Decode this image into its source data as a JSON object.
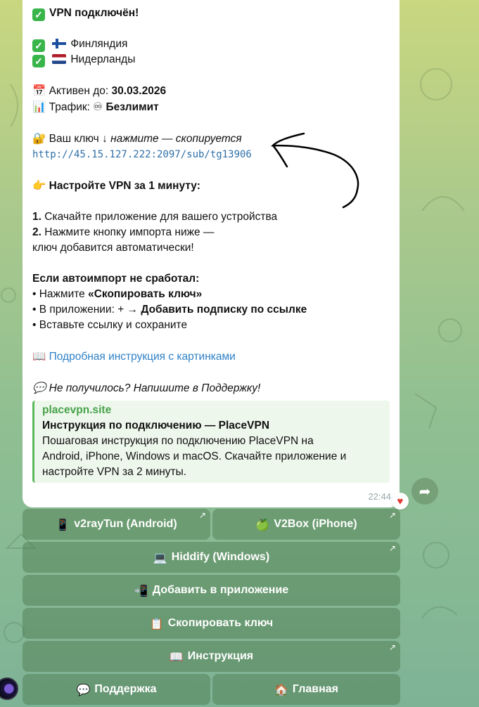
{
  "message": {
    "title": "VPN подключён!",
    "servers": [
      {
        "flag": "finland",
        "name": "Финляндия"
      },
      {
        "flag": "netherlands",
        "name": "Нидерланды"
      }
    ],
    "active_label": "Активен до:",
    "active_value": "30.03.2026",
    "traffic_label": "Трафик:",
    "traffic_value": "Безлимит",
    "key_label": "Ваш ключ ↓",
    "key_hint": "нажмите — скопируется",
    "key_url": "http://45.15.127.222:2097/sub/tg13906",
    "setup_title": "Настройте VPN за 1 минуту:",
    "step1_num": "1.",
    "step1_text": "Скачайте приложение для вашего устройства",
    "step2_num": "2.",
    "step2_text": "Нажмите кнопку импорта ниже —",
    "step2_cont": "ключ добавится автоматически!",
    "fallback_title": "Если автоимпорт не сработал:",
    "fb1_pre": "• Нажмите ",
    "fb1_bold": "«Скопировать ключ»",
    "fb2_pre": "• В приложении: + → ",
    "fb2_bold": "Добавить подписку по ссылке",
    "fb3": "• Вставьте ссылку и сохраните",
    "guide_link": "Подробная инструкция с картинками",
    "support_text": "Не получилось? Напишите в Поддержку!",
    "preview": {
      "site": "placevpn.site",
      "title": "Инструкция по подключению — PlaceVPN",
      "desc1": "Пошаговая инструкция по подключению PlaceVPN на",
      "desc2": "Android, iPhone, Windows и macOS. Скачайте приложение и",
      "desc3": "настройте VPN за 2 минуты."
    },
    "time": "22:44"
  },
  "buttons": {
    "v2raytun": "v2rayTun (Android)",
    "v2box": "V2Box (iPhone)",
    "hiddify": "Hiddify (Windows)",
    "add_app": "Добавить в приложение",
    "copy_key": "Скопировать ключ",
    "instruction": "Инструкция",
    "support": "Поддержка",
    "home": "Главная"
  },
  "colors": {
    "accent_link": "#2f81c7",
    "preview_green": "#47a24a",
    "button_bg": "#46734a"
  }
}
